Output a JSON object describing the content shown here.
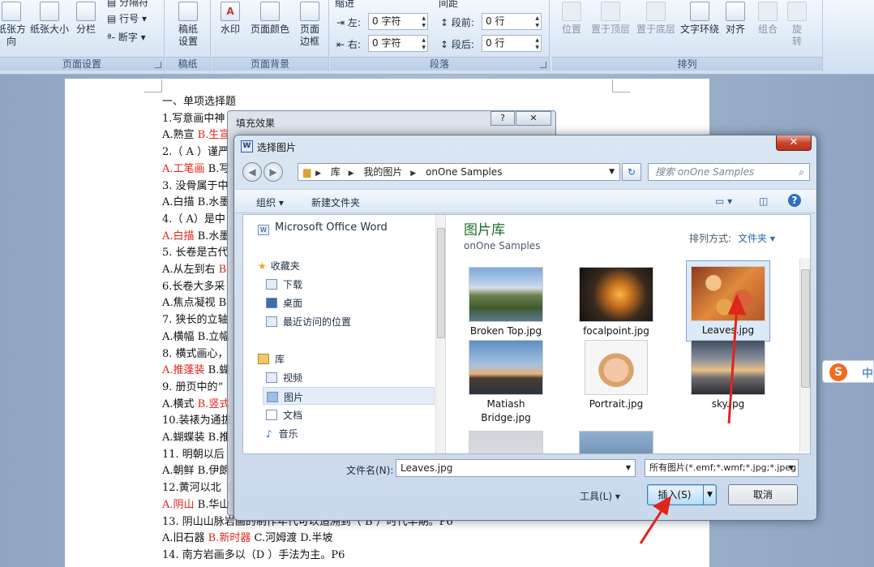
{
  "ribbon": {
    "groups": {
      "page_setup": {
        "label": "页面设置",
        "buttons": [
          "纸张方向",
          "纸张大小",
          "分栏"
        ],
        "small": [
          "分隔符",
          "行号",
          "断字"
        ]
      },
      "manuscript": {
        "label": "稿纸",
        "buttons": [
          "稿纸设置"
        ]
      },
      "page_bg": {
        "label": "页面背景",
        "buttons": [
          "水印",
          "页面颜色",
          "页面边框"
        ]
      },
      "paragraph": {
        "label": "段落",
        "indent_title": "缩进",
        "spacing_title": "间距",
        "left_label": "左:",
        "left_value": "0 字符",
        "right_label": "右:",
        "right_value": "0 字符",
        "before_label": "段前:",
        "before_value": "0 行",
        "after_label": "段后:",
        "after_value": "0 行"
      },
      "arrange": {
        "label": "排列",
        "buttons": [
          "位置",
          "置于顶层",
          "置于底层",
          "文字环绕",
          "对齐",
          "组合",
          "旋转"
        ]
      }
    }
  },
  "document": {
    "lines": [
      {
        "parts": [
          {
            "t": "一、单项选择题"
          }
        ]
      },
      {
        "parts": [
          {
            "t": "1.写意画中神"
          }
        ]
      },
      {
        "parts": [
          {
            "t": "A.熟宣 "
          },
          {
            "t": "B.生宣",
            "red": true
          }
        ]
      },
      {
        "parts": [
          {
            "t": "2.（ A ）谨严"
          }
        ]
      },
      {
        "parts": [
          {
            "t": "A.工笔画",
            "red": true
          },
          {
            "t": " B.写"
          }
        ]
      },
      {
        "parts": [
          {
            "t": "3. 没骨属于中"
          }
        ]
      },
      {
        "parts": [
          {
            "t": "A.白描 B.水墨"
          }
        ]
      },
      {
        "parts": [
          {
            "t": "4.（  A）是中"
          }
        ]
      },
      {
        "parts": [
          {
            "t": "A.白描",
            "red": true
          },
          {
            "t": " B.水墨"
          }
        ]
      },
      {
        "parts": [
          {
            "t": "5. 长卷是古代"
          }
        ]
      },
      {
        "parts": [
          {
            "t": "A.从左到右 "
          },
          {
            "t": "B",
            "red": true
          }
        ]
      },
      {
        "parts": [
          {
            "t": "6.长卷大多采"
          }
        ]
      },
      {
        "parts": [
          {
            "t": "A.焦点凝视 B"
          }
        ]
      },
      {
        "parts": [
          {
            "t": "7. 狭长的立轴"
          }
        ]
      },
      {
        "parts": [
          {
            "t": "A.横幅 B.立幅"
          }
        ]
      },
      {
        "parts": [
          {
            "t": "8. 横式画心，"
          }
        ]
      },
      {
        "parts": [
          {
            "t": "A.推蓬装",
            "red": true
          },
          {
            "t": " B.蝴"
          }
        ]
      },
      {
        "parts": [
          {
            "t": "9. 册页中的“"
          }
        ]
      },
      {
        "parts": [
          {
            "t": "A.横式 "
          },
          {
            "t": "B.竖式",
            "red": true
          }
        ]
      },
      {
        "parts": [
          {
            "t": "10.装裱为通拔"
          }
        ]
      },
      {
        "parts": [
          {
            "t": "A.蝴蝶装 B.推"
          }
        ]
      },
      {
        "parts": [
          {
            "t": "11. 明朝以后"
          }
        ]
      },
      {
        "parts": [
          {
            "t": "A.朝鲜 B.伊朗"
          }
        ]
      },
      {
        "parts": [
          {
            "t": "12.黄河以北（"
          }
        ]
      },
      {
        "parts": [
          {
            "t": "A.阴山",
            "red": true
          },
          {
            "t": " B.华山"
          }
        ]
      },
      {
        "parts": [
          {
            "t": "13. 阴山山脉岩画的制作年代可以追溯到（ B ）时代早期。P6"
          }
        ]
      },
      {
        "parts": [
          {
            "t": "A.旧石器 "
          },
          {
            "t": "B.新时器",
            "red": true
          },
          {
            "t": " C.河姆渡 D.半坡"
          }
        ]
      },
      {
        "parts": [
          {
            "t": "14. 南方岩画多以（D  ）手法为主。P6"
          }
        ]
      }
    ]
  },
  "fill_dialog": {
    "title": "填充效果",
    "help": "?",
    "close": "✕"
  },
  "dialog": {
    "title": "选择图片",
    "icon_letter": "W",
    "close": "✕",
    "breadcrumb": [
      "库",
      "我的图片",
      "onOne Samples"
    ],
    "search_placeholder": "搜索 onOne Samples",
    "toolbar": {
      "organize": "组织 ▾",
      "new_folder": "新建文件夹"
    },
    "nav": {
      "app": "Microsoft Office Word",
      "favorites": "收藏夹",
      "fav_items": [
        "下载",
        "桌面",
        "最近访问的位置"
      ],
      "libraries": "库",
      "lib_items": [
        "视频",
        "图片",
        "文档",
        "音乐"
      ]
    },
    "library_title": "图片库",
    "library_sub": "onOne Samples",
    "arrange_label": "排列方式:",
    "arrange_value": "文件夹 ▾",
    "files": [
      "Broken Top.jpg",
      "focalpoint.jpg",
      "Leaves.jpg",
      "Matiash Bridge.jpg",
      "Portrait.jpg",
      "sky.jpg"
    ],
    "filename_label": "文件名(N):",
    "filename_value": "Leaves.jpg",
    "filetype_value": "所有图片(*.emf;*.wmf;*.jpg;*.jpeg",
    "tools_label": "工具(L)",
    "insert_label": "插入(S)",
    "cancel_label": "取消"
  },
  "ime": {
    "letter": "S",
    "mode": "中"
  },
  "colors": {
    "accent": "#3c7fb1",
    "annotation_red": "#e0251b"
  }
}
